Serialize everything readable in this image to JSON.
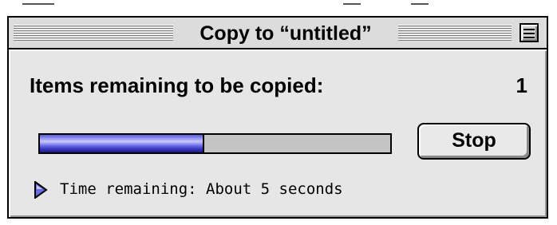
{
  "window": {
    "title": "Copy to “untitled”",
    "collapse_icon": "collapse-box-icon"
  },
  "status": {
    "items_label": "Items remaining to be copied:",
    "items_count": "1"
  },
  "progress": {
    "fraction": 0.47,
    "fill_color": "#4a4ad8",
    "track_color": "#c4c4c4"
  },
  "buttons": {
    "stop_label": "Stop"
  },
  "time": {
    "disclosure_icon": "disclosure-triangle-icon",
    "label": "Time remaining: About 5 seconds"
  },
  "colors": {
    "window_bg": "#e6e6e6",
    "accent": "#4a4ad8"
  }
}
